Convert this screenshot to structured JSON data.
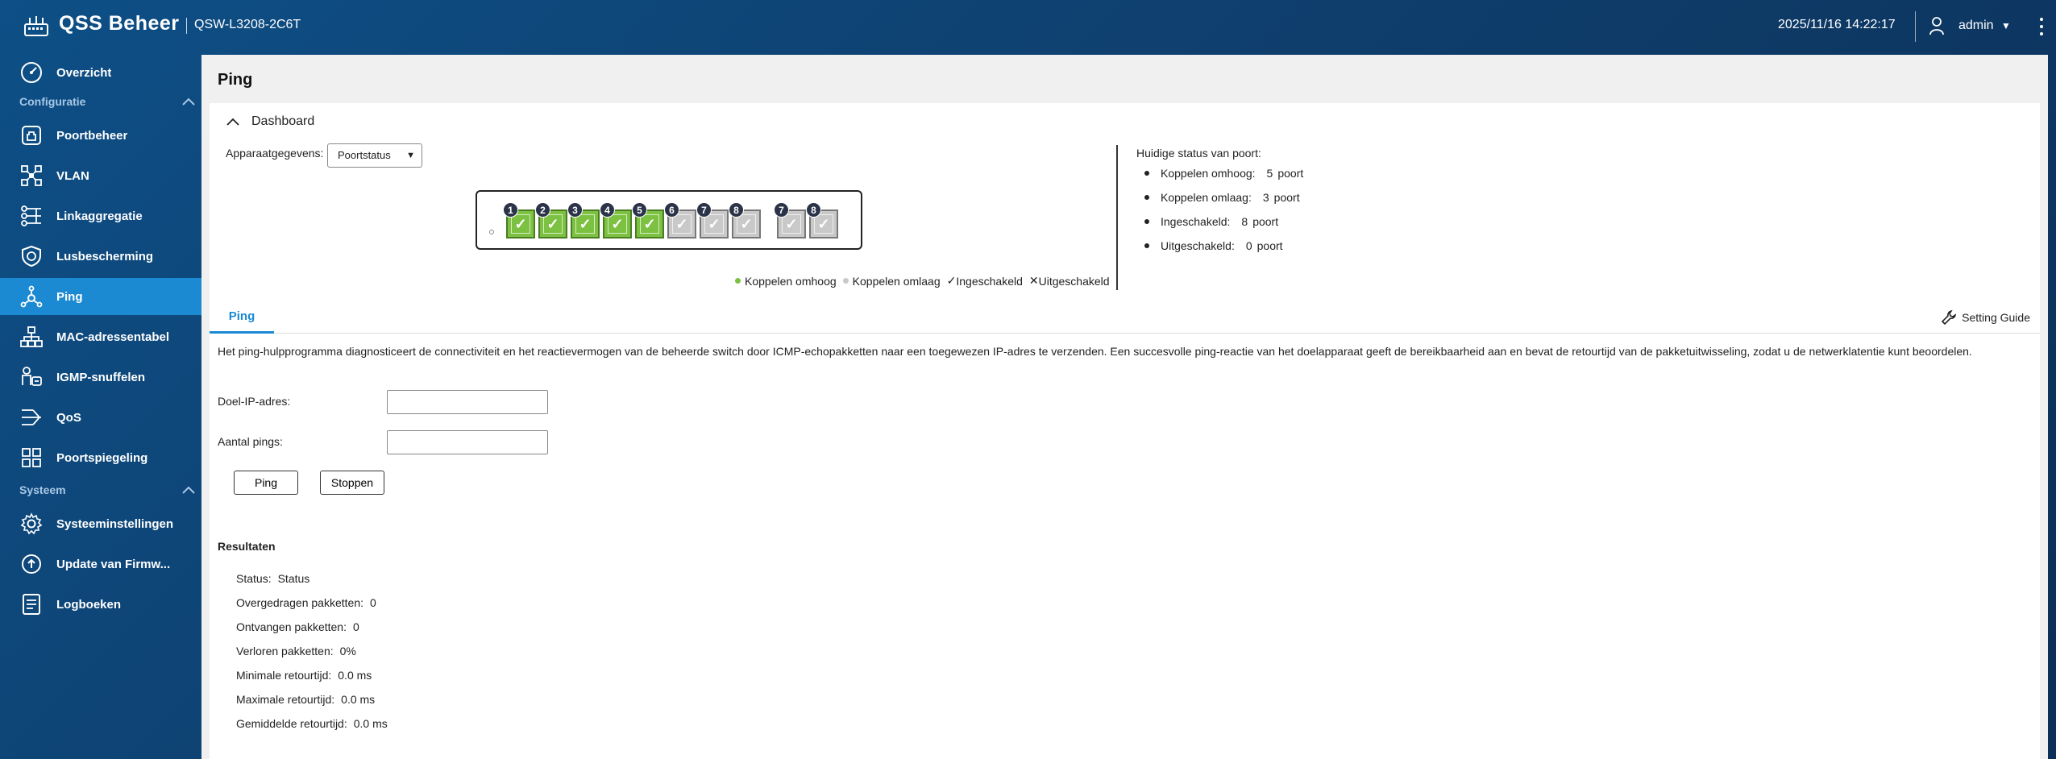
{
  "header": {
    "app_title": "QSS Beheer",
    "device_name": "QSW-L3208-2C6T",
    "datetime": "2025/11/16  14:22:17",
    "user": "admin"
  },
  "sidebar": {
    "overview": "Overzicht",
    "section_config": "Configuratie",
    "items_config": [
      {
        "label": "Poortbeheer",
        "icon": "port-icon"
      },
      {
        "label": "VLAN",
        "icon": "vlan-icon"
      },
      {
        "label": "Linkaggregatie",
        "icon": "link-aggregation-icon"
      },
      {
        "label": "Lusbescherming",
        "icon": "shield-icon"
      },
      {
        "label": "Ping",
        "icon": "ping-icon"
      },
      {
        "label": "MAC-adressentabel",
        "icon": "mac-table-icon"
      },
      {
        "label": "IGMP-snuffelen",
        "icon": "igmp-icon"
      },
      {
        "label": "QoS",
        "icon": "qos-icon"
      },
      {
        "label": "Poortspiegeling",
        "icon": "port-mirror-icon"
      }
    ],
    "section_system": "Systeem",
    "items_system": [
      {
        "label": "Systeeminstellingen",
        "icon": "gear-icon"
      },
      {
        "label": "Update van Firmw...",
        "icon": "firmware-update-icon"
      },
      {
        "label": "Logboeken",
        "icon": "logs-icon"
      }
    ]
  },
  "page": {
    "title": "Ping"
  },
  "dashboard": {
    "title": "Dashboard",
    "device_label": "Apparaatgegevens:",
    "dropdown_value": "Poortstatus",
    "ports": [
      {
        "num": "1",
        "state": "up"
      },
      {
        "num": "2",
        "state": "up"
      },
      {
        "num": "3",
        "state": "up"
      },
      {
        "num": "4",
        "state": "up"
      },
      {
        "num": "5",
        "state": "up"
      },
      {
        "num": "6",
        "state": "down"
      },
      {
        "num": "7",
        "state": "down"
      },
      {
        "num": "8",
        "state": "down"
      },
      {
        "num": "7",
        "state": "down"
      },
      {
        "num": "8",
        "state": "down"
      }
    ],
    "legend": {
      "link_up": "Koppelen omhoog",
      "link_down": "Koppelen omlaag",
      "enabled": "Ingeschakeld",
      "disabled": "Uitgeschakeld"
    },
    "colors": {
      "link_up": "#7dc142",
      "link_down": "#c9c9c9",
      "accent": "#1b8ad3"
    },
    "status_title": "Huidige status van poort:",
    "status": [
      {
        "label": "Koppelen omhoog:",
        "value": "5",
        "unit": "poort"
      },
      {
        "label": "Koppelen omlaag:",
        "value": "3",
        "unit": "poort"
      },
      {
        "label": "Ingeschakeld:",
        "value": "8",
        "unit": "poort"
      },
      {
        "label": "Uitgeschakeld:",
        "value": "0",
        "unit": "poort"
      }
    ]
  },
  "ping": {
    "tab_label": "Ping",
    "guide_label": "Setting Guide",
    "description": "Het ping-hulpprogramma diagnosticeert de connectiviteit en het reactievermogen van de beheerde switch door ICMP-echopakketten naar een toegewezen IP-adres te verzenden. Een succesvolle ping-reactie van het doelapparaat geeft de bereikbaarheid aan en bevat de retourtijd van de pakketuitwisseling, zodat u de netwerklatentie kunt beoordelen.",
    "target_ip_label": "Doel-IP-adres:",
    "target_ip_value": "",
    "count_label": "Aantal pings:",
    "count_value": "",
    "ping_button": "Ping",
    "stop_button": "Stoppen",
    "results_title": "Resultaten",
    "results": [
      {
        "label": "Status:",
        "value": "Status"
      },
      {
        "label": "Overgedragen pakketten:",
        "value": "0"
      },
      {
        "label": "Ontvangen pakketten:",
        "value": "0"
      },
      {
        "label": "Verloren pakketten:",
        "value": "0%"
      },
      {
        "label": "Minimale retourtijd:",
        "value": "0.0  ms"
      },
      {
        "label": "Maximale retourtijd:",
        "value": "0.0  ms"
      },
      {
        "label": "Gemiddelde retourtijd:",
        "value": "0.0  ms"
      }
    ]
  }
}
